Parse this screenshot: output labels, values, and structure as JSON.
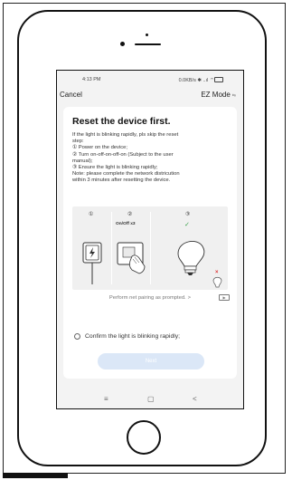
{
  "status_bar": {
    "time": "4:13 PM",
    "network": "0.0KB/s ✱ ..ıl ⌔"
  },
  "nav": {
    "cancel": "Cancel",
    "mode": "EZ Mode",
    "mode_icon_glyph": "⇆"
  },
  "card": {
    "title": "Reset the device first.",
    "lines": [
      "If the light is blinking rapidly, pls skip the reset",
      "step:",
      "① Power on the device;",
      "② Turn on-off-on-off-on (Subject to the user",
      "manual);",
      "③ Ensure the light is blinking rapidly;",
      "Note: please complete the network districution",
      "within 3 minutes after resetting the device."
    ]
  },
  "steps": {
    "one": "①",
    "two": "②",
    "three": "③",
    "onoff": "On/Off x3",
    "check": "✓",
    "cross": "×"
  },
  "pairing": {
    "text": "Perform net pairing as prompted.",
    "arrow": ">",
    "video": "▶"
  },
  "confirm": {
    "label": "Confirm the light is blinking rapidly;"
  },
  "next_button": {
    "label": "Next"
  },
  "system_nav": {
    "menu": "≡",
    "home": "▢",
    "back": "<"
  },
  "colors": {
    "accent_disabled": "#dbe7f7",
    "check_green": "#3aa04a",
    "cross_red": "#d33333"
  }
}
